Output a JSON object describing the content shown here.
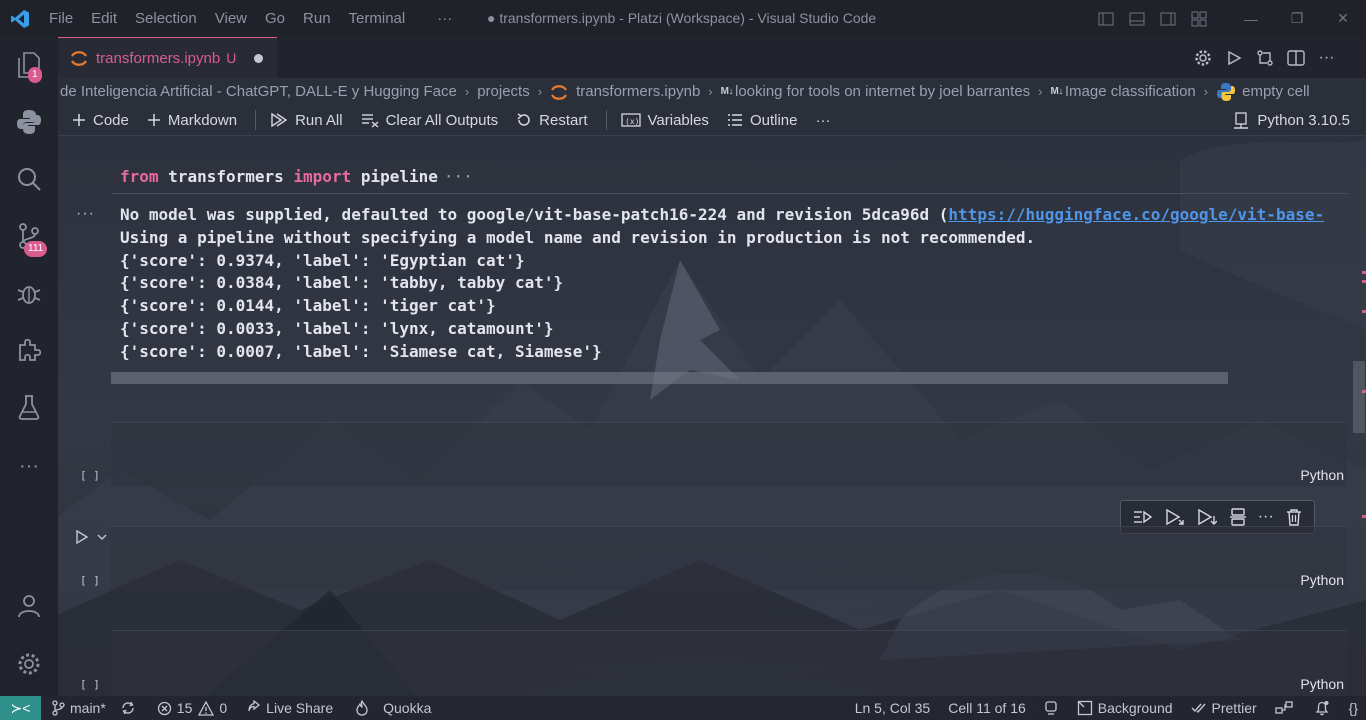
{
  "window": {
    "title": "● transformers.ipynb - Platzi (Workspace) - Visual Studio Code",
    "menu": [
      "File",
      "Edit",
      "Selection",
      "View",
      "Go",
      "Run",
      "Terminal",
      "···"
    ]
  },
  "activity_bar": {
    "items": [
      {
        "icon": "explorer-icon",
        "badge": "1"
      },
      {
        "icon": "python-icon",
        "badge": ""
      },
      {
        "icon": "search-icon",
        "badge": ""
      },
      {
        "icon": "source-control-icon",
        "badge": "111"
      },
      {
        "icon": "debug-icon",
        "badge": ""
      },
      {
        "icon": "extensions-icon",
        "badge": ""
      },
      {
        "icon": "testing-icon",
        "badge": ""
      },
      {
        "icon": "more-icon",
        "badge": ""
      }
    ],
    "bottom": [
      {
        "icon": "account-icon"
      },
      {
        "icon": "manage-gear-icon"
      }
    ]
  },
  "tab": {
    "name": "transformers.ipynb",
    "status": "U"
  },
  "breadcrumb": {
    "items": [
      "de Inteligencia Artificial - ChatGPT, DALL-E y Hugging Face",
      "projects",
      "transformers.ipynb",
      "looking for tools on internet by joel barrantes",
      "Image classification",
      "empty cell"
    ]
  },
  "notebook_toolbar": {
    "code": "Code",
    "markdown": "Markdown",
    "run_all": "Run All",
    "clear_outputs": "Clear All Outputs",
    "restart": "Restart",
    "variables": "Variables",
    "outline": "Outline",
    "more": "···",
    "kernel": "Python 3.10.5"
  },
  "cells": {
    "code_line": {
      "kw1": "from",
      "mod": "transformers",
      "kw2": "import",
      "name": "pipeline",
      "ellipsis": "···"
    },
    "output_more": "···",
    "output": {
      "line1_prefix": "No model was supplied, defaulted to google/vit-base-patch16-224 and revision 5dca96d (",
      "line1_link": "https://huggingface.co/google/vit-base-",
      "line2": "Using a pipeline without specifying a model name and revision in production is not recommended.",
      "results": [
        "{'score': 0.9374, 'label': 'Egyptian cat'}",
        "{'score': 0.0384, 'label': 'tabby, tabby cat'}",
        "{'score': 0.0144, 'label': 'tiger cat'}",
        "{'score': 0.0033, 'label': 'lynx, catamount'}",
        "{'score': 0.0007, 'label': 'Siamese cat, Siamese'}"
      ]
    },
    "empty": [
      {
        "exec": "[ ]",
        "lang": "Python"
      },
      {
        "exec": "[ ]",
        "lang": "Python"
      },
      {
        "exec": "[ ]",
        "lang": "Python"
      }
    ]
  },
  "status_bar": {
    "branch": "main*",
    "errors": "15",
    "warnings": "0",
    "live_share": "Live Share",
    "quokka": "Quokka",
    "position": "Ln 5, Col 35",
    "cell": "Cell 11 of 16",
    "background": "Background",
    "prettier": "Prettier",
    "braces": "{}"
  },
  "colors": {
    "accent": "#d95c8f",
    "link": "#4f95e8",
    "remote": "#2f8f8a"
  }
}
